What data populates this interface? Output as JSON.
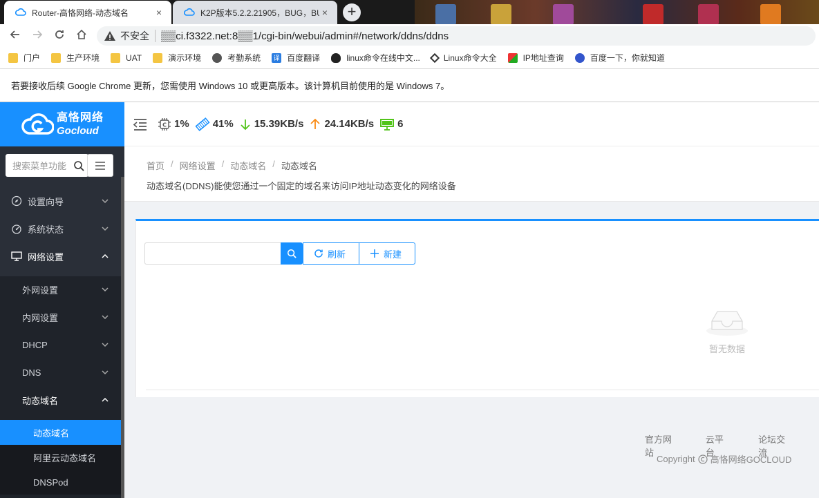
{
  "browser": {
    "tabs": [
      {
        "title": "Router-高恪网络-动态域名",
        "active": true
      },
      {
        "title": "K2P版本5.2.2.21905，BUG，BU",
        "active": false
      }
    ],
    "new_tab_symbol": "+",
    "close_symbol": "×",
    "security_label": "不安全",
    "url": "▒▒ci.f3322.net:8▒▒1/cgi-bin/webui/admin#/network/ddns/ddns",
    "bookmarks": [
      {
        "label": "门户",
        "icon": "folder-icon"
      },
      {
        "label": "生产环境",
        "icon": "folder-icon"
      },
      {
        "label": "UAT",
        "icon": "folder-icon"
      },
      {
        "label": "演示环境",
        "icon": "folder-icon"
      },
      {
        "label": "考勤系统",
        "icon": "globe-icon"
      },
      {
        "label": "百度翻译",
        "icon": "translate-icon",
        "glyph": "译"
      },
      {
        "label": "linux命令在线中文...",
        "icon": "penguin-icon"
      },
      {
        "label": "Linux命令大全",
        "icon": "diamond-icon"
      },
      {
        "label": "IP地址查询",
        "icon": "ip-icon"
      },
      {
        "label": "百度一下，你就知道",
        "icon": "paw-icon"
      }
    ],
    "infobar_text": "若要接收后续 Google Chrome 更新，您需使用 Windows 10 或更高版本。该计算机目前使用的是 Windows 7。"
  },
  "app": {
    "brand_cn": "高恪网络",
    "brand_en": "Gocloud",
    "stats": {
      "cpu": "1%",
      "memory": "41%",
      "download": "15.39KB/s",
      "upload": "24.14KB/s",
      "devices": "6"
    },
    "colors": {
      "accent": "#1890ff",
      "download": "#52c41a",
      "upload": "#fa8c16",
      "devices": "#52c41a"
    },
    "sidebar": {
      "search_placeholder": "搜索菜单功能",
      "items": [
        {
          "label": "设置向导",
          "icon": "compass-icon",
          "expanded": false
        },
        {
          "label": "系统状态",
          "icon": "dashboard-icon",
          "expanded": false
        },
        {
          "label": "网络设置",
          "icon": "monitor-icon",
          "expanded": true
        }
      ],
      "network_children": [
        {
          "label": "外网设置"
        },
        {
          "label": "内网设置"
        },
        {
          "label": "DHCP"
        },
        {
          "label": "DNS"
        },
        {
          "label": "动态域名",
          "expanded": true
        }
      ],
      "ddns_children": [
        {
          "label": "动态域名",
          "active": true
        },
        {
          "label": "阿里云动态域名"
        },
        {
          "label": "DNSPod"
        }
      ]
    },
    "breadcrumb": [
      "首页",
      "网络设置",
      "动态域名",
      "动态域名"
    ],
    "breadcrumb_sep": "/",
    "description": "动态域名(DDNS)能使您通过一个固定的域名来访问IP地址动态变化的网络设备",
    "toolbar": {
      "search_value": "",
      "refresh_label": "刷新",
      "create_label": "新建"
    },
    "empty_text": "暂无数据",
    "footer": {
      "links": [
        "官方网站",
        "云平台",
        "论坛交流"
      ],
      "copyright_prefix": "Copyright",
      "copyright_owner": "高恪网络GOCLOUD"
    }
  }
}
